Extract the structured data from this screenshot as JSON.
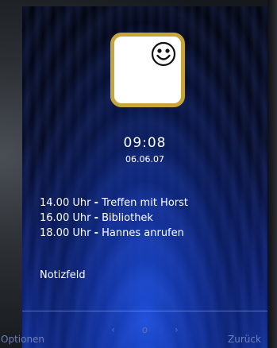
{
  "status": {
    "time": "09:08",
    "date": "06.06.07"
  },
  "avatar": {
    "icon": "smiley-icon",
    "border_color": "#c6a63a"
  },
  "events": [
    {
      "time": "14.00 Uhr",
      "separator": "-",
      "title": "Treffen mit Horst"
    },
    {
      "time": "16.00 Uhr",
      "separator": "-",
      "title": "Bibliothek"
    },
    {
      "time": "18.00 Uhr",
      "separator": "-",
      "title": "Hannes anrufen"
    }
  ],
  "note_field": "Notizfeld",
  "navigation": {
    "prev_glyph": "‹",
    "dot_glyph": "o",
    "next_glyph": "›"
  },
  "softkeys": {
    "left": "Optionen",
    "right": "Zurück"
  }
}
